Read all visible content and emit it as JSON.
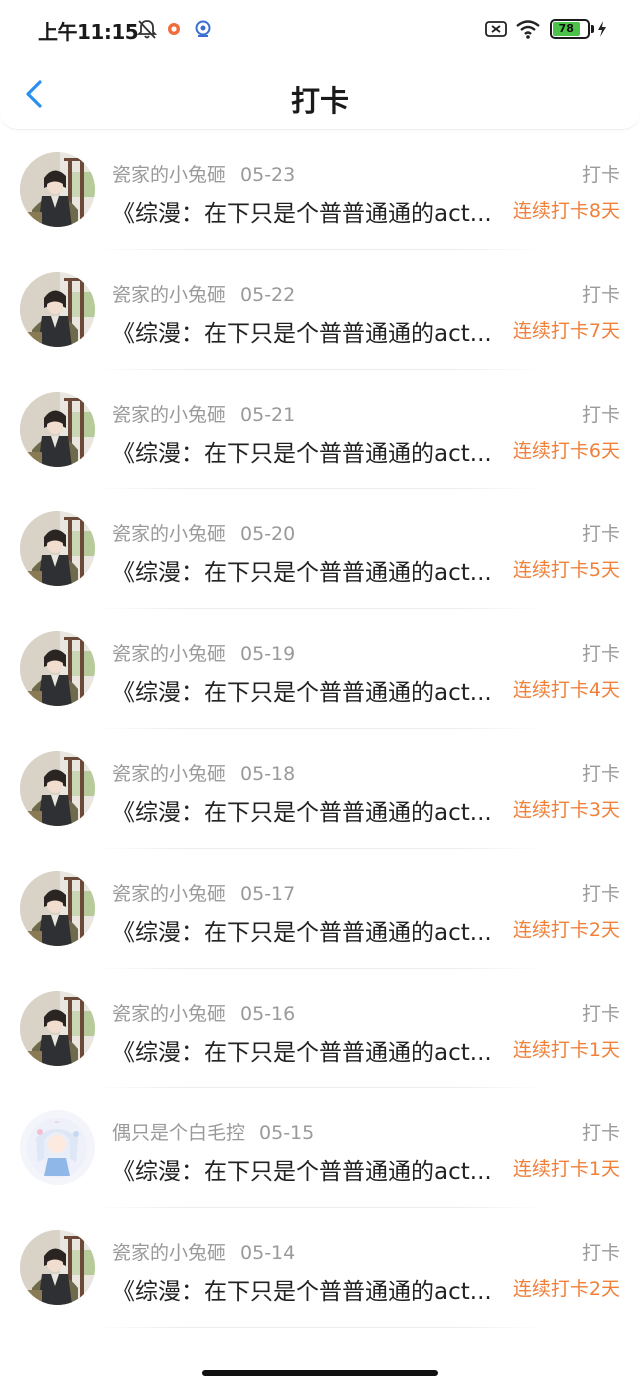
{
  "status_bar": {
    "time": "上午11:15",
    "battery": "78",
    "icons": [
      "bell-off-icon",
      "app-notification-icon",
      "location-icon",
      "sim-disabled-icon",
      "wifi-icon",
      "battery-icon",
      "charging-icon"
    ]
  },
  "header": {
    "title": "打卡",
    "back_icon": "chevron-left-icon",
    "accent_color": "#2b8ff0"
  },
  "colors": {
    "streak": "#f0803a",
    "meta": "#9a9a9a"
  },
  "items": [
    {
      "user": "瓷家的小兔砸",
      "date": "05-23",
      "tag": "打卡",
      "book": "《综漫：在下只是个普普通通的act...",
      "streak": "连续打卡8天",
      "avatar": "dark-hair-character-avatar"
    },
    {
      "user": "瓷家的小兔砸",
      "date": "05-22",
      "tag": "打卡",
      "book": "《综漫：在下只是个普普通通的act...",
      "streak": "连续打卡7天",
      "avatar": "dark-hair-character-avatar"
    },
    {
      "user": "瓷家的小兔砸",
      "date": "05-21",
      "tag": "打卡",
      "book": "《综漫：在下只是个普普通通的act...",
      "streak": "连续打卡6天",
      "avatar": "dark-hair-character-avatar"
    },
    {
      "user": "瓷家的小兔砸",
      "date": "05-20",
      "tag": "打卡",
      "book": "《综漫：在下只是个普普通通的act...",
      "streak": "连续打卡5天",
      "avatar": "dark-hair-character-avatar"
    },
    {
      "user": "瓷家的小兔砸",
      "date": "05-19",
      "tag": "打卡",
      "book": "《综漫：在下只是个普普通通的act...",
      "streak": "连续打卡4天",
      "avatar": "dark-hair-character-avatar"
    },
    {
      "user": "瓷家的小兔砸",
      "date": "05-18",
      "tag": "打卡",
      "book": "《综漫：在下只是个普普通通的act...",
      "streak": "连续打卡3天",
      "avatar": "dark-hair-character-avatar"
    },
    {
      "user": "瓷家的小兔砸",
      "date": "05-17",
      "tag": "打卡",
      "book": "《综漫：在下只是个普普通通的act...",
      "streak": "连续打卡2天",
      "avatar": "dark-hair-character-avatar"
    },
    {
      "user": "瓷家的小兔砸",
      "date": "05-16",
      "tag": "打卡",
      "book": "《综漫：在下只是个普普通通的act...",
      "streak": "连续打卡1天",
      "avatar": "dark-hair-character-avatar"
    },
    {
      "user": "偶只是个白毛控",
      "date": "05-15",
      "tag": "打卡",
      "book": "《综漫：在下只是个普普通通的act...",
      "streak": "连续打卡1天",
      "avatar": "white-hair-chibi-avatar"
    },
    {
      "user": "瓷家的小兔砸",
      "date": "05-14",
      "tag": "打卡",
      "book": "《综漫：在下只是个普普通通的act...",
      "streak": "连续打卡2天",
      "avatar": "dark-hair-character-avatar"
    }
  ]
}
